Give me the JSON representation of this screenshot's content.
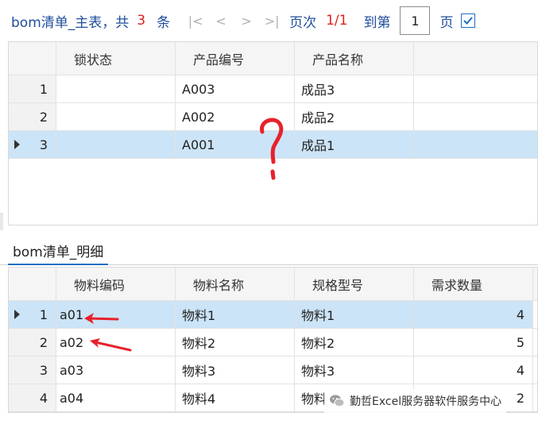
{
  "master": {
    "title": "bom清单_主表，共",
    "count": "3",
    "count_unit": "条",
    "pager": {
      "first": "|<",
      "prev": "<",
      "next": ">",
      "last": ">|",
      "page_label": "页次",
      "page_info": "1/1",
      "goto_label": "到第",
      "goto_value": "1",
      "page_unit": "页"
    },
    "columns": [
      "锁状态",
      "产品编号",
      "产品名称"
    ],
    "rows": [
      {
        "no": "1",
        "lock": "",
        "code": "A003",
        "name": "成品3"
      },
      {
        "no": "2",
        "lock": "",
        "code": "A002",
        "name": "成品2"
      },
      {
        "no": "3",
        "lock": "",
        "code": "A001",
        "name": "成品1"
      }
    ]
  },
  "detail": {
    "tab_label": "bom清单_明细",
    "columns": [
      "物料编码",
      "物料名称",
      "规格型号",
      "需求数量"
    ],
    "rows": [
      {
        "no": "1",
        "code": "a01",
        "name": "物料1",
        "spec": "物料1",
        "qty": "4"
      },
      {
        "no": "2",
        "code": "a02",
        "name": "物料2",
        "spec": "物料2",
        "qty": "5"
      },
      {
        "no": "3",
        "code": "a03",
        "name": "物料3",
        "spec": "物料3",
        "qty": "4"
      },
      {
        "no": "4",
        "code": "a04",
        "name": "物料4",
        "spec": "物料",
        "qty": "2"
      }
    ]
  },
  "watermark": "勤哲Excel服务器软件服务中心",
  "colors": {
    "accent": "#1f4e9c",
    "highlight": "#e02020",
    "selected_row": "#cce4f7",
    "annotation": "#e8212b"
  }
}
